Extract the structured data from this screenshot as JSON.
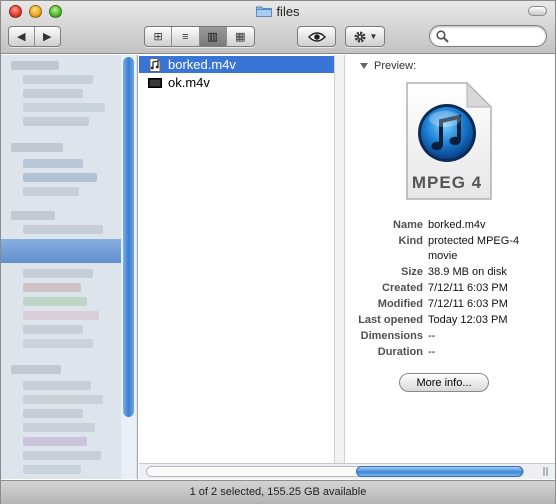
{
  "window": {
    "title": "files",
    "folder_icon": "folder-icon"
  },
  "toolbar": {
    "nav": [
      {
        "icon": "back-arrow-icon",
        "glyph": "◀"
      },
      {
        "icon": "forward-arrow-icon",
        "glyph": "▶"
      }
    ],
    "views": [
      {
        "icon": "icon-view-icon",
        "glyph": "⊞"
      },
      {
        "icon": "list-view-icon",
        "glyph": "≡"
      },
      {
        "icon": "column-view-icon",
        "glyph": "▥",
        "active": true
      },
      {
        "icon": "cover-flow-icon",
        "glyph": "▦"
      }
    ],
    "quick_look_icon": "eye-icon",
    "action_icon": "gear-icon",
    "search_icon": "magnifier-icon",
    "search_value": ""
  },
  "files": [
    {
      "name": "borked.m4v",
      "icon": "music-file-icon",
      "selected": true
    },
    {
      "name": "ok.m4v",
      "icon": "movie-file-icon",
      "selected": false
    }
  ],
  "preview": {
    "header": "Preview:",
    "icon_label": "MPEG 4",
    "info": [
      {
        "key": "Name",
        "value": "borked.m4v"
      },
      {
        "key": "Kind",
        "value": "protected MPEG-4 movie"
      },
      {
        "key": "Size",
        "value": "38.9 MB on disk"
      },
      {
        "key": "Created",
        "value": "7/12/11 6:03 PM"
      },
      {
        "key": "Modified",
        "value": "7/12/11 6:03 PM"
      },
      {
        "key": "Last opened",
        "value": "Today 12:03 PM"
      },
      {
        "key": "Dimensions",
        "value": "--"
      },
      {
        "key": "Duration",
        "value": "--"
      }
    ],
    "more_info_label": "More info..."
  },
  "status": {
    "text": "1 of 2 selected, 155.25 GB available"
  },
  "colors": {
    "selection": "#3875d7",
    "sidebar": "#dde4ec",
    "scroll_thumb": "#3c86d6"
  }
}
